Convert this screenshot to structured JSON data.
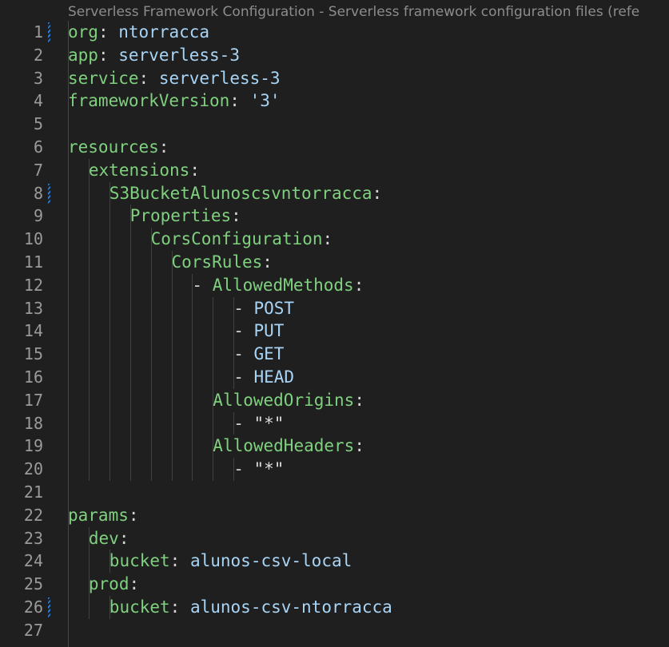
{
  "editor": {
    "schema_hint": "Serverless Framework Configuration - Serverless framework configuration files (refe",
    "colors": {
      "background": "#1f1f1f",
      "key": "#7fd17f",
      "value": "#a8d4f5",
      "line_number": "#9a9a9a",
      "gutter_change": "#2f79c9"
    },
    "lines": [
      {
        "n": "1",
        "indent": 0,
        "key": "org",
        "value": "ntorracca",
        "changed": true
      },
      {
        "n": "2",
        "indent": 0,
        "key": "app",
        "value": "serverless-3"
      },
      {
        "n": "3",
        "indent": 0,
        "key": "service",
        "value": "serverless-3"
      },
      {
        "n": "4",
        "indent": 0,
        "key": "frameworkVersion",
        "value": "'3'"
      },
      {
        "n": "5",
        "indent": 0
      },
      {
        "n": "6",
        "indent": 0,
        "key": "resources"
      },
      {
        "n": "7",
        "indent": 1,
        "key": "extensions"
      },
      {
        "n": "8",
        "indent": 2,
        "key": "S3BucketAlunoscsvntorracca",
        "changed": true
      },
      {
        "n": "9",
        "indent": 3,
        "key": "Properties"
      },
      {
        "n": "10",
        "indent": 4,
        "key": "CorsConfiguration"
      },
      {
        "n": "11",
        "indent": 5,
        "key": "CorsRules"
      },
      {
        "n": "12",
        "indent": 6,
        "dash": true,
        "key": "AllowedMethods"
      },
      {
        "n": "13",
        "indent": 8,
        "dash": true,
        "value": "POST"
      },
      {
        "n": "14",
        "indent": 8,
        "dash": true,
        "value": "PUT"
      },
      {
        "n": "15",
        "indent": 8,
        "dash": true,
        "value": "GET"
      },
      {
        "n": "16",
        "indent": 8,
        "dash": true,
        "value": "HEAD"
      },
      {
        "n": "17",
        "indent": 7,
        "key": "AllowedOrigins"
      },
      {
        "n": "18",
        "indent": 8,
        "dash": true,
        "value": "\"*\"",
        "plain": true
      },
      {
        "n": "19",
        "indent": 7,
        "key": "AllowedHeaders"
      },
      {
        "n": "20",
        "indent": 8,
        "dash": true,
        "value": "\"*\"",
        "plain": true
      },
      {
        "n": "21",
        "indent": 0
      },
      {
        "n": "22",
        "indent": 0,
        "key": "params"
      },
      {
        "n": "23",
        "indent": 1,
        "key": "dev"
      },
      {
        "n": "24",
        "indent": 2,
        "key": "bucket",
        "value": "alunos-csv-local"
      },
      {
        "n": "25",
        "indent": 1,
        "key": "prod"
      },
      {
        "n": "26",
        "indent": 2,
        "key": "bucket",
        "value": "alunos-csv-ntorracca",
        "changed": true
      },
      {
        "n": "27",
        "indent": 0
      }
    ]
  }
}
